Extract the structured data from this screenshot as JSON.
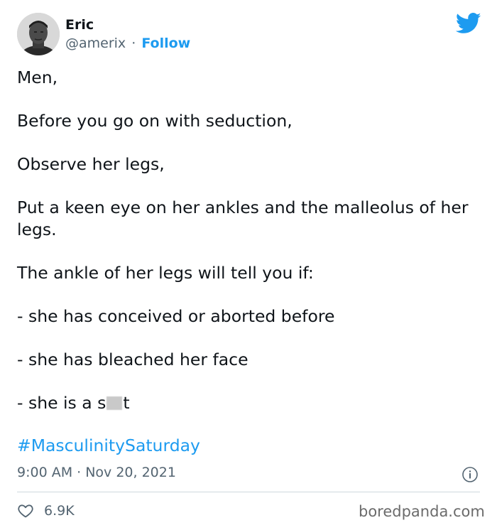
{
  "tweet": {
    "author_name": "Eric",
    "handle": "@amerix",
    "separator": "·",
    "follow_label": "Follow",
    "paragraphs": [
      "Men,",
      "Before you go on with seduction,",
      "Observe her legs,",
      "Put a keen eye on her ankles and the malleolus of her legs.",
      "The ankle of her legs will tell you if:",
      "- she has conceived or aborted before",
      "- she has bleached her face"
    ],
    "last_line_start": "- she is a s",
    "last_line_end": "t",
    "hashtag": "#MasculinitySaturday",
    "timestamp": "9:00 AM · Nov 20, 2021",
    "like_count": "6.9K"
  },
  "watermark": "boredpanda.com",
  "icons": {
    "brand": "twitter-bird-icon",
    "info": "info-icon",
    "like": "heart-icon"
  },
  "colors": {
    "accent": "#1d9bf0",
    "secondary_text": "#536471",
    "primary_text": "#0f1419",
    "divider": "#cfd9de"
  }
}
